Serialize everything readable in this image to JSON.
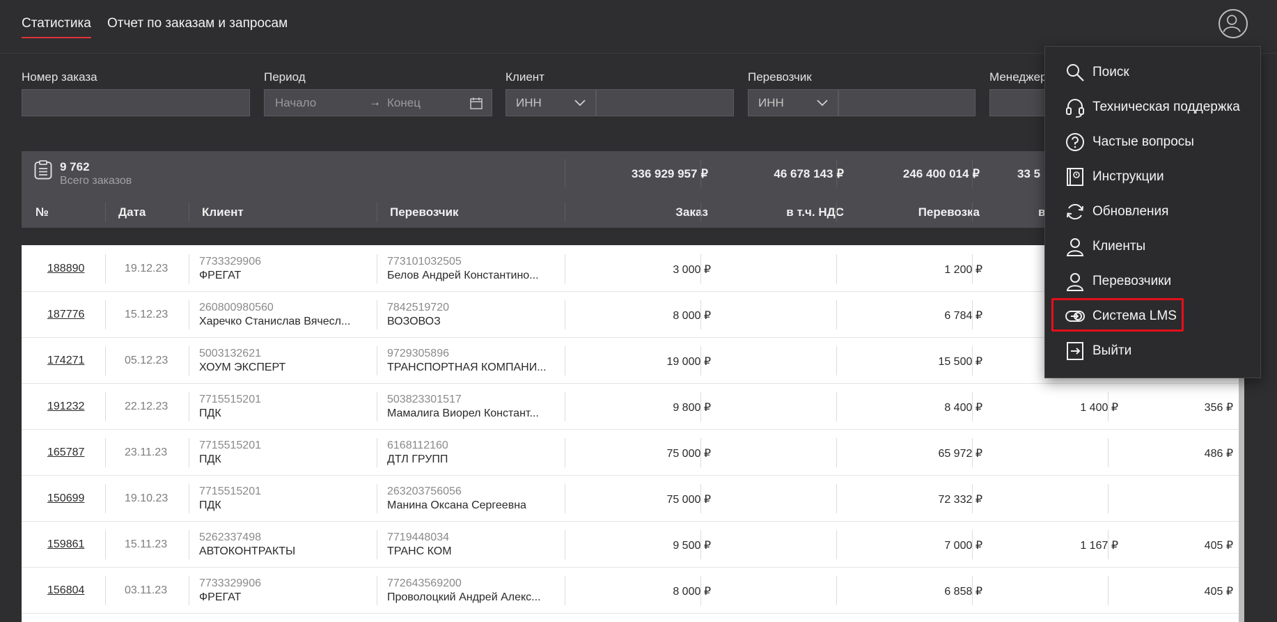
{
  "nav": {
    "tabs": [
      {
        "label": "Статистика",
        "active": true
      },
      {
        "label": "Отчет по заказам и запросам",
        "active": false
      }
    ]
  },
  "filters": {
    "order_number": {
      "label": "Номер заказа",
      "value": ""
    },
    "period": {
      "label": "Период",
      "start_placeholder": "Начало",
      "arrow": "→",
      "end_placeholder": "Конец"
    },
    "client": {
      "label": "Клиент",
      "select": "ИНН",
      "value": ""
    },
    "carrier": {
      "label": "Перевозчик",
      "select": "ИНН",
      "value": ""
    },
    "manager": {
      "label": "Менеджер"
    }
  },
  "summary": {
    "total_count": "9 762",
    "total_label": "Всего заказов",
    "order_sum": "336 929 957 ₽",
    "vat_sum": "46 678 143 ₽",
    "transport_sum": "246 400 014 ₽",
    "fourth_sum": "33 5"
  },
  "columns": {
    "number": "№",
    "date": "Дата",
    "client": "Клиент",
    "carrier": "Перевозчик",
    "order": "Заказ",
    "vat": "в т.ч. НДС",
    "transport": "Перевозка",
    "fourth": "в"
  },
  "rows": [
    {
      "number": "188890",
      "date": "19.12.23",
      "client_inn": "7733329906",
      "client_name": "ФРЕГАТ",
      "carrier_inn": "773101032505",
      "carrier_name": "Белов Андрей Константино...",
      "order": "3 000 ₽",
      "vat": "",
      "transport": "1 200 ₽",
      "col8": "",
      "col9": ""
    },
    {
      "number": "187776",
      "date": "15.12.23",
      "client_inn": "260800980560",
      "client_name": "Харечко Станислав Вячесл...",
      "carrier_inn": "7842519720",
      "carrier_name": "ВОЗОВОЗ",
      "order": "8 000 ₽",
      "vat": "",
      "transport": "6 784 ₽",
      "col8": "",
      "col9": ""
    },
    {
      "number": "174271",
      "date": "05.12.23",
      "client_inn": "5003132621",
      "client_name": "ХОУМ ЭКСПЕРТ",
      "carrier_inn": "9729305896",
      "carrier_name": "ТРАНСПОРТНАЯ КОМПАНИ...",
      "order": "19 000 ₽",
      "vat": "",
      "transport": "15 500 ₽",
      "col8": "",
      "col9": ""
    },
    {
      "number": "191232",
      "date": "22.12.23",
      "client_inn": "7715515201",
      "client_name": "ПДК",
      "carrier_inn": "503823301517",
      "carrier_name": "Мамалига Виорел Констант...",
      "order": "9 800 ₽",
      "vat": "",
      "transport": "8 400 ₽",
      "col8": "1 400 ₽",
      "col9": "356 ₽"
    },
    {
      "number": "165787",
      "date": "23.11.23",
      "client_inn": "7715515201",
      "client_name": "ПДК",
      "carrier_inn": "6168112160",
      "carrier_name": "ДТЛ ГРУПП",
      "order": "75 000 ₽",
      "vat": "",
      "transport": "65 972 ₽",
      "col8": "",
      "col9": "486 ₽"
    },
    {
      "number": "150699",
      "date": "19.10.23",
      "client_inn": "7715515201",
      "client_name": "ПДК",
      "carrier_inn": "263203756056",
      "carrier_name": "Манина Оксана Сергеевна",
      "order": "75 000 ₽",
      "vat": "",
      "transport": "72 332 ₽",
      "col8": "",
      "col9": ""
    },
    {
      "number": "159861",
      "date": "15.11.23",
      "client_inn": "5262337498",
      "client_name": "АВТОКОНТРАКТЫ",
      "carrier_inn": "7719448034",
      "carrier_name": "ТРАНС КОМ",
      "order": "9 500 ₽",
      "vat": "",
      "transport": "7 000 ₽",
      "col8": "1 167 ₽",
      "col9": "405 ₽"
    },
    {
      "number": "156804",
      "date": "03.11.23",
      "client_inn": "7733329906",
      "client_name": "ФРЕГАТ",
      "carrier_inn": "772643569200",
      "carrier_name": "Проволоцкий Андрей Алекс...",
      "order": "8 000 ₽",
      "vat": "",
      "transport": "6 858 ₽",
      "col8": "",
      "col9": "405 ₽"
    }
  ],
  "menu": {
    "items": [
      {
        "label": "Поиск",
        "icon": "search-icon"
      },
      {
        "label": "Техническая поддержка",
        "icon": "headset-icon"
      },
      {
        "label": "Частые вопросы",
        "icon": "question-icon"
      },
      {
        "label": "Инструкции",
        "icon": "book-icon"
      },
      {
        "label": "Обновления",
        "icon": "refresh-icon"
      },
      {
        "label": "Клиенты",
        "icon": "user-icon"
      },
      {
        "label": "Перевозчики",
        "icon": "user-icon"
      },
      {
        "label": "Система LMS",
        "icon": "lms-icon"
      },
      {
        "label": "Выйти",
        "icon": "logout-icon"
      }
    ]
  },
  "colors": {
    "accent": "#e0313a",
    "highlight": "#e3101a"
  }
}
